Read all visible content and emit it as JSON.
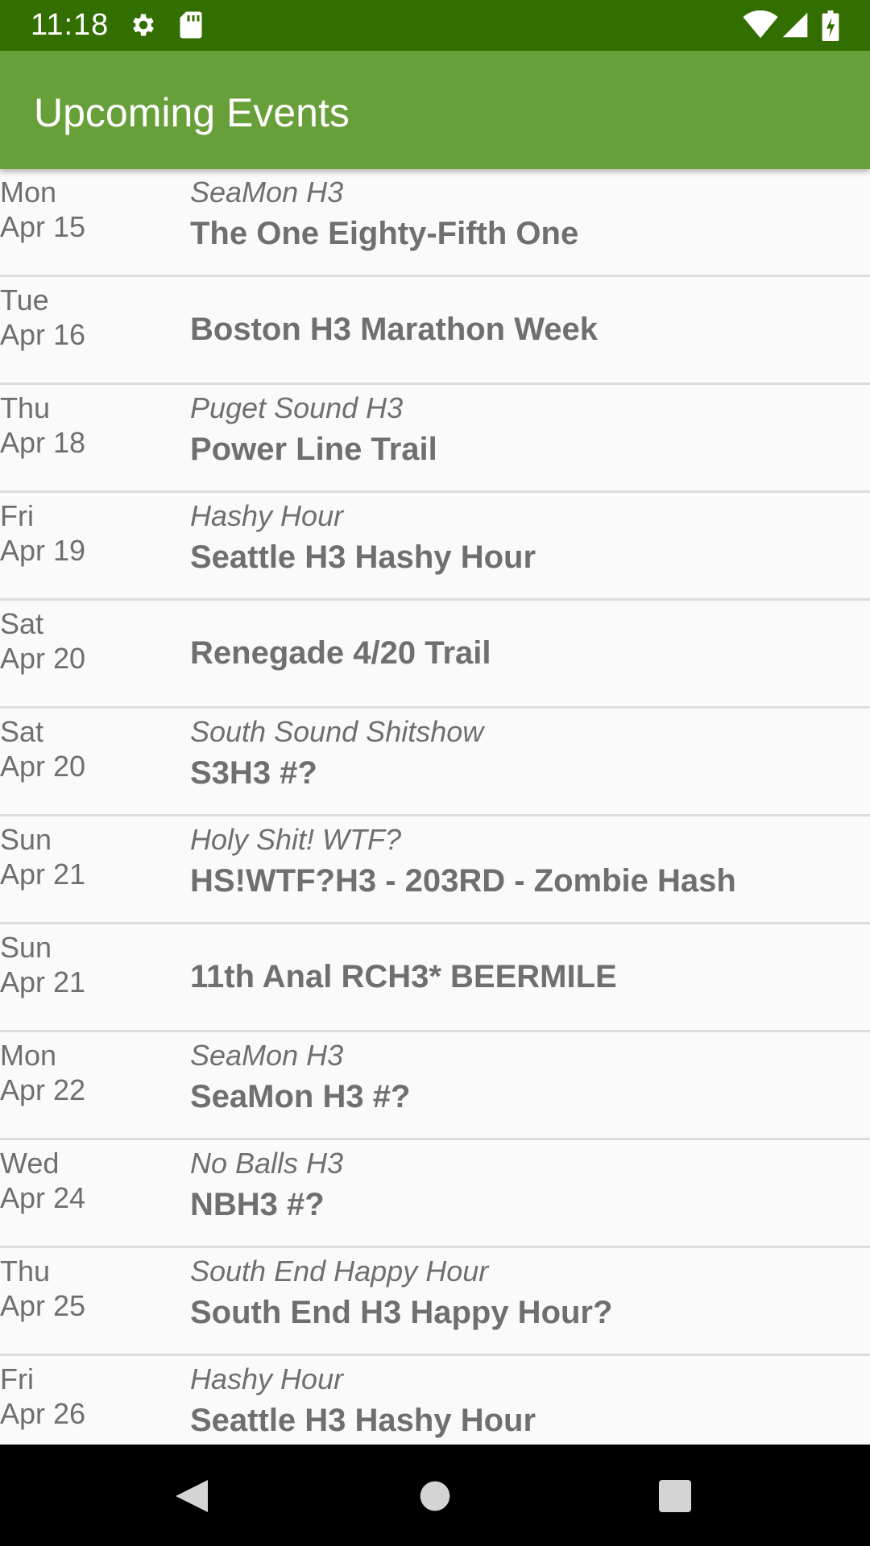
{
  "status_bar": {
    "time": "11:18",
    "icons": [
      "gear-icon",
      "sd-card-icon",
      "wifi-icon",
      "signal-icon",
      "battery-icon"
    ],
    "background": "#336e00"
  },
  "app_bar": {
    "title": "Upcoming Events",
    "background": "#679f38"
  },
  "events": [
    {
      "day": "Mon",
      "date": "Apr 15",
      "kennel": "SeaMon H3",
      "name": "The One Eighty-Fifth One"
    },
    {
      "day": "Tue",
      "date": "Apr 16",
      "kennel": "",
      "name": "Boston H3 Marathon Week"
    },
    {
      "day": "Thu",
      "date": "Apr 18",
      "kennel": "Puget Sound H3",
      "name": "Power Line Trail"
    },
    {
      "day": "Fri",
      "date": "Apr 19",
      "kennel": "Hashy Hour",
      "name": "Seattle H3 Hashy Hour"
    },
    {
      "day": "Sat",
      "date": "Apr 20",
      "kennel": "",
      "name": "Renegade 4/20 Trail"
    },
    {
      "day": "Sat",
      "date": "Apr 20",
      "kennel": "South Sound Shitshow",
      "name": "S3H3 #?"
    },
    {
      "day": "Sun",
      "date": "Apr 21",
      "kennel": "Holy Shit! WTF?",
      "name": "HS!WTF?H3 - 203RD - Zombie Hash"
    },
    {
      "day": "Sun",
      "date": "Apr 21",
      "kennel": "",
      "name": "11th Anal RCH3* BEERMILE"
    },
    {
      "day": "Mon",
      "date": "Apr 22",
      "kennel": "SeaMon H3",
      "name": "SeaMon H3 #?"
    },
    {
      "day": "Wed",
      "date": "Apr 24",
      "kennel": "No Balls H3",
      "name": "NBH3 #?"
    },
    {
      "day": "Thu",
      "date": "Apr 25",
      "kennel": "South End Happy Hour",
      "name": "South End H3 Happy Hour?"
    },
    {
      "day": "Fri",
      "date": "Apr 26",
      "kennel": "Hashy Hour",
      "name": "Seattle H3 Hashy Hour"
    }
  ],
  "nav_bar": {
    "icons": [
      "back-icon",
      "home-icon",
      "recents-icon"
    ]
  }
}
